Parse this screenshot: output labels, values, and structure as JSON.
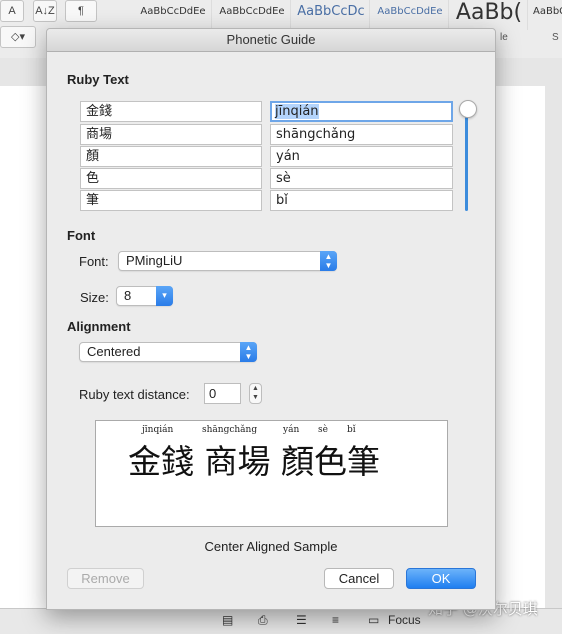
{
  "toolbar": {
    "style_samples": [
      "AaBbCcDdEe",
      "AaBbCcDdEe",
      "AaBbCcDc",
      "AaBbCcDdEe",
      "AaBb(",
      "AaBbCcDdEe"
    ],
    "partial_labels": [
      "A",
      "A↓Z",
      "¶",
      "le",
      "S"
    ]
  },
  "dialog": {
    "title": "Phonetic Guide",
    "ruby_section": "Ruby Text",
    "rows": [
      {
        "base": "金錢",
        "ruby": "jīnqián"
      },
      {
        "base": "商場",
        "ruby": "shāngchǎng"
      },
      {
        "base": "顏",
        "ruby": "yán"
      },
      {
        "base": "色",
        "ruby": "sè"
      },
      {
        "base": "筆",
        "ruby": "bǐ"
      }
    ],
    "font_section": "Font",
    "font_label": "Font:",
    "font_value": "PMingLiU",
    "size_label": "Size:",
    "size_value": "8",
    "alignment_section": "Alignment",
    "alignment_value": "Centered",
    "distance_label": "Ruby text distance:",
    "distance_value": "0",
    "preview": {
      "ruby": [
        "jīnqián",
        "shāngchǎng",
        "yán",
        "sè",
        "bǐ"
      ],
      "base": "金錢 商場 顏色筆"
    },
    "caption": "Center Aligned Sample",
    "buttons": {
      "remove": "Remove",
      "cancel": "Cancel",
      "ok": "OK"
    }
  },
  "statusbar": {
    "focus_label": "Focus"
  },
  "watermark": "知乎 @沃尔贝琪",
  "colors": {
    "accent": "#2a7ce8",
    "selection": "#b3d4fc",
    "dialog_bg": "#ececec"
  }
}
